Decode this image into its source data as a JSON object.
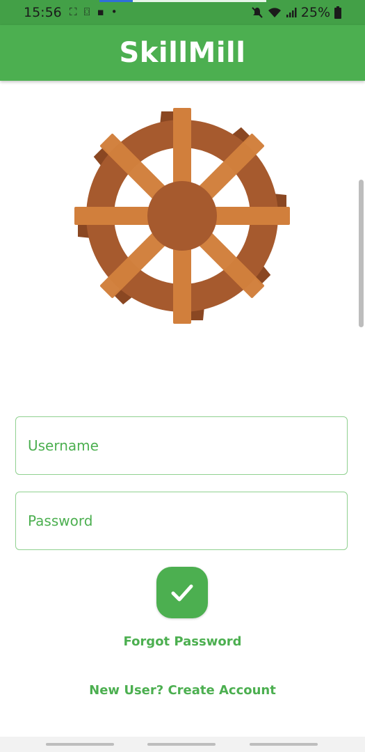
{
  "status_bar": {
    "time": "15:56",
    "battery": "25%",
    "left_icons": [
      "screenshot-icon",
      "screen-record-icon",
      "message-icon",
      "dot-icon"
    ],
    "right_icons": [
      "mute-icon",
      "wifi-icon",
      "signal-icon",
      "battery-icon"
    ]
  },
  "app_bar": {
    "title": "SkillMill"
  },
  "logo": {
    "icon": "waterwheel-icon"
  },
  "form": {
    "username_placeholder": "Username",
    "password_placeholder": "Password",
    "submit_icon": "checkmark-icon"
  },
  "links": {
    "forgot_password": "Forgot Password",
    "create_account": "New User? Create Account"
  },
  "colors": {
    "primary": "#4caf50",
    "status_bar": "#43a047",
    "wheel_dark": "#a65a2e",
    "wheel_light": "#d17f3c"
  }
}
